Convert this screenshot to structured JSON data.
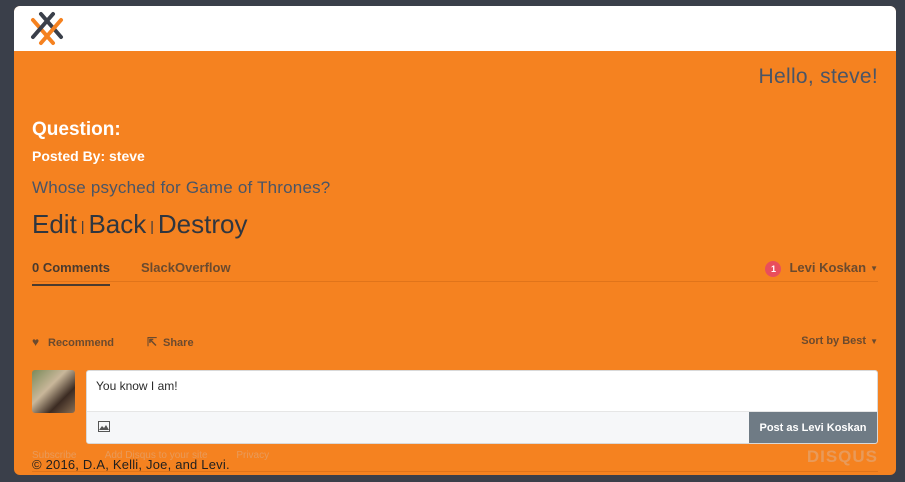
{
  "header": {
    "logo_icon": "crosshatch-logo-icon"
  },
  "greeting": "Hello, steve!",
  "question": {
    "heading": "Question:",
    "posted_by_label": "Posted By:",
    "posted_by_user": "steve",
    "body": "Whose psyched for Game of Thrones?"
  },
  "actions": {
    "edit": "Edit",
    "back": "Back",
    "destroy": "Destroy",
    "separator": "|"
  },
  "disqus": {
    "tabs": {
      "comments": "0 Comments",
      "community": "SlackOverflow"
    },
    "user": {
      "notification_count": "1",
      "name": "Levi Koskan"
    },
    "toolbar": {
      "recommend": "Recommend",
      "share": "Share",
      "sort": "Sort by Best"
    },
    "composer": {
      "value": "You know I am!",
      "post_button": "Post as Levi Koskan"
    },
    "footer": {
      "subscribe": "Subscribe",
      "add": "Add Disqus to your site",
      "privacy": "Privacy",
      "brand": "DISQUS"
    }
  },
  "copyright": "© 2016, D.A, Kelli, Joe, and Levi.",
  "colors": {
    "background": "#f58220",
    "text_dark": "#4a5566",
    "button": "#6f7b85"
  }
}
